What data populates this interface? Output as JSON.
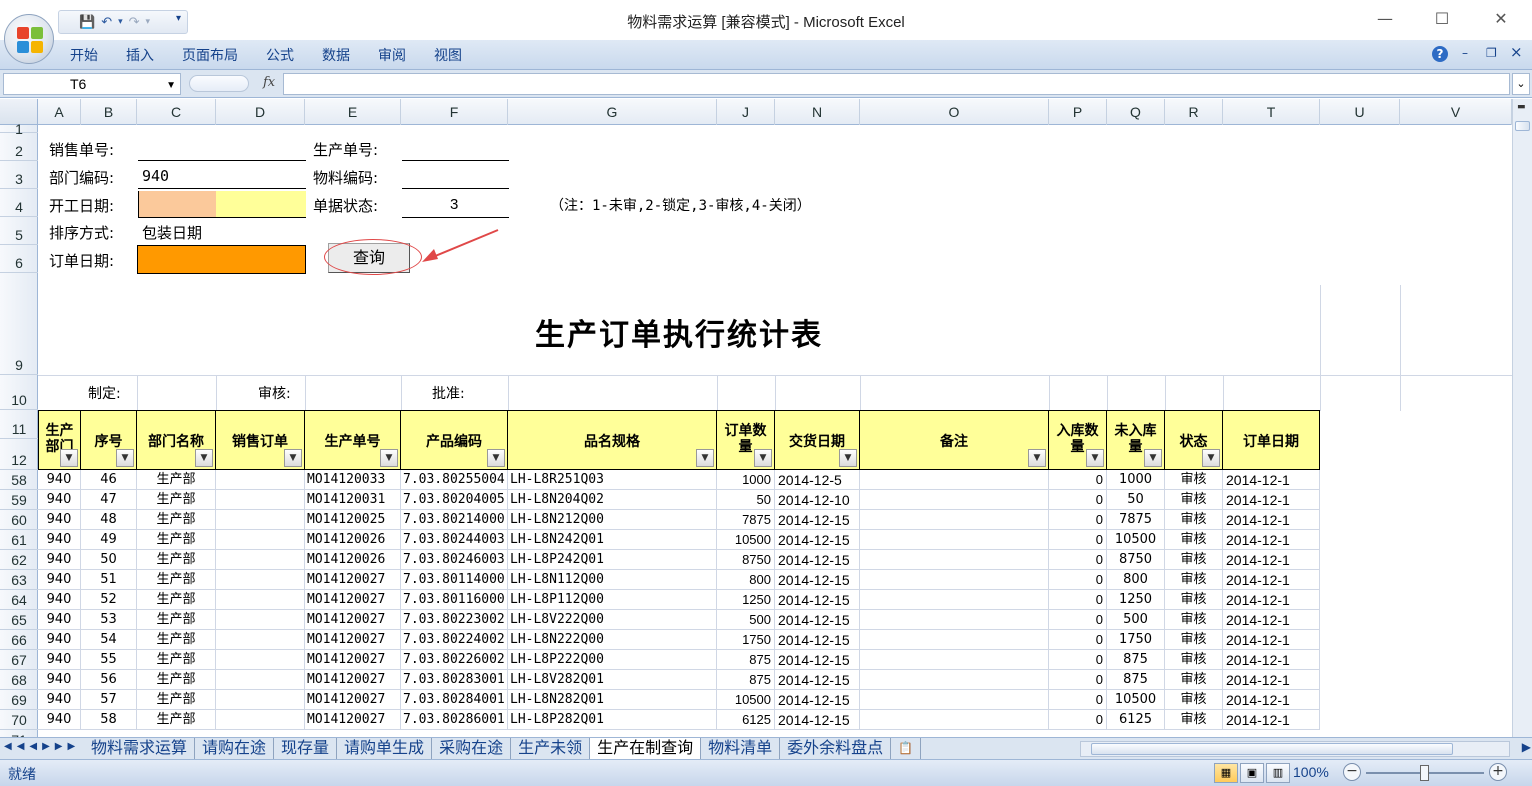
{
  "window": {
    "title": "物料需求运算  [兼容模式] - Microsoft Excel",
    "minimize": "—",
    "maximize": "☐",
    "close": "✕"
  },
  "qat": {
    "save": "💾",
    "undo": "↶",
    "redo": "↷",
    "more": "▾"
  },
  "ribbon": {
    "tabs": [
      "开始",
      "插入",
      "页面布局",
      "公式",
      "数据",
      "审阅",
      "视图"
    ],
    "help": "?",
    "min": "–",
    "restore": "❐",
    "close": "×"
  },
  "formula_bar": {
    "name_box": "T6",
    "fx": "fx",
    "value": ""
  },
  "columns": [
    "A",
    "B",
    "C",
    "D",
    "E",
    "F",
    "G",
    "J",
    "N",
    "O",
    "P",
    "Q",
    "R",
    "T",
    "U",
    "V"
  ],
  "row_numbers": [
    "1",
    "2",
    "3",
    "4",
    "5",
    "6",
    "9",
    "10",
    "11",
    "12",
    "58",
    "59",
    "60",
    "61",
    "62",
    "63",
    "64",
    "65",
    "66",
    "67",
    "68",
    "69",
    "70",
    "71"
  ],
  "form": {
    "sales_no_label": "销售单号:",
    "prod_no_label": "生产单号:",
    "dept_label": "部门编码:",
    "dept_value": "940",
    "material_label": "物料编码:",
    "start_date_label": "开工日期:",
    "status_label": "单据状态:",
    "status_value": "3",
    "status_note": "（注：1-未审,2-锁定,3-审核,4-关闭）",
    "sort_label": "排序方式:",
    "sort_value": "包装日期",
    "order_date_label": "订单日期:",
    "query_button": "查询"
  },
  "report": {
    "title": "生产订单执行统计表",
    "made_by": "制定:",
    "reviewed_by": "审核:",
    "approved_by": "批准:"
  },
  "table_headers": {
    "dept": "生产部门",
    "seq": "序号",
    "dept_name": "部门名称",
    "sales_order": "销售订单",
    "prod_no": "生产单号",
    "product_code": "产品编码",
    "spec": "品名规格",
    "order_qty": "订单数量",
    "delivery_date": "交货日期",
    "remark": "备注",
    "in_qty": "入库数量",
    "not_in_qty": "未入库量",
    "status": "状态",
    "order_date": "订单日期"
  },
  "rows": [
    {
      "dept": "940",
      "seq": "46",
      "dname": "生产部",
      "prod": "MO14120033",
      "code": "7.03.80255004",
      "spec": "LH-L8R251Q03",
      "qty": "1000",
      "date": "2014-12-5",
      "in": "0",
      "left": "1000",
      "st": "审核",
      "od": "2014-12-1"
    },
    {
      "dept": "940",
      "seq": "47",
      "dname": "生产部",
      "prod": "MO14120031",
      "code": "7.03.80204005",
      "spec": "LH-L8N204Q02",
      "qty": "50",
      "date": "2014-12-10",
      "in": "0",
      "left": "50",
      "st": "审核",
      "od": "2014-12-1"
    },
    {
      "dept": "940",
      "seq": "48",
      "dname": "生产部",
      "prod": "MO14120025",
      "code": "7.03.80214000",
      "spec": "LH-L8N212Q00",
      "qty": "7875",
      "date": "2014-12-15",
      "in": "0",
      "left": "7875",
      "st": "审核",
      "od": "2014-12-1"
    },
    {
      "dept": "940",
      "seq": "49",
      "dname": "生产部",
      "prod": "MO14120026",
      "code": "7.03.80244003",
      "spec": "LH-L8N242Q01",
      "qty": "10500",
      "date": "2014-12-15",
      "in": "0",
      "left": "10500",
      "st": "审核",
      "od": "2014-12-1"
    },
    {
      "dept": "940",
      "seq": "50",
      "dname": "生产部",
      "prod": "MO14120026",
      "code": "7.03.80246003",
      "spec": "LH-L8P242Q01",
      "qty": "8750",
      "date": "2014-12-15",
      "in": "0",
      "left": "8750",
      "st": "审核",
      "od": "2014-12-1"
    },
    {
      "dept": "940",
      "seq": "51",
      "dname": "生产部",
      "prod": "MO14120027",
      "code": "7.03.80114000",
      "spec": "LH-L8N112Q00",
      "qty": "800",
      "date": "2014-12-15",
      "in": "0",
      "left": "800",
      "st": "审核",
      "od": "2014-12-1"
    },
    {
      "dept": "940",
      "seq": "52",
      "dname": "生产部",
      "prod": "MO14120027",
      "code": "7.03.80116000",
      "spec": "LH-L8P112Q00",
      "qty": "1250",
      "date": "2014-12-15",
      "in": "0",
      "left": "1250",
      "st": "审核",
      "od": "2014-12-1"
    },
    {
      "dept": "940",
      "seq": "53",
      "dname": "生产部",
      "prod": "MO14120027",
      "code": "7.03.80223002",
      "spec": "LH-L8V222Q00",
      "qty": "500",
      "date": "2014-12-15",
      "in": "0",
      "left": "500",
      "st": "审核",
      "od": "2014-12-1"
    },
    {
      "dept": "940",
      "seq": "54",
      "dname": "生产部",
      "prod": "MO14120027",
      "code": "7.03.80224002",
      "spec": "LH-L8N222Q00",
      "qty": "1750",
      "date": "2014-12-15",
      "in": "0",
      "left": "1750",
      "st": "审核",
      "od": "2014-12-1"
    },
    {
      "dept": "940",
      "seq": "55",
      "dname": "生产部",
      "prod": "MO14120027",
      "code": "7.03.80226002",
      "spec": "LH-L8P222Q00",
      "qty": "875",
      "date": "2014-12-15",
      "in": "0",
      "left": "875",
      "st": "审核",
      "od": "2014-12-1"
    },
    {
      "dept": "940",
      "seq": "56",
      "dname": "生产部",
      "prod": "MO14120027",
      "code": "7.03.80283001",
      "spec": "LH-L8V282Q01",
      "qty": "875",
      "date": "2014-12-15",
      "in": "0",
      "left": "875",
      "st": "审核",
      "od": "2014-12-1"
    },
    {
      "dept": "940",
      "seq": "57",
      "dname": "生产部",
      "prod": "MO14120027",
      "code": "7.03.80284001",
      "spec": "LH-L8N282Q01",
      "qty": "10500",
      "date": "2014-12-15",
      "in": "0",
      "left": "10500",
      "st": "审核",
      "od": "2014-12-1"
    },
    {
      "dept": "940",
      "seq": "58",
      "dname": "生产部",
      "prod": "MO14120027",
      "code": "7.03.80286001",
      "spec": "LH-L8P282Q01",
      "qty": "6125",
      "date": "2014-12-15",
      "in": "0",
      "left": "6125",
      "st": "审核",
      "od": "2014-12-1"
    }
  ],
  "sheet_tabs": [
    "物料需求运算",
    "请购在途",
    "现存量",
    "请购单生成",
    "采购在途",
    "生产未领",
    "生产在制查询",
    "物料清单",
    "委外余料盘点"
  ],
  "active_sheet": "生产在制查询",
  "status": {
    "ready": "就绪",
    "zoom": "100%"
  },
  "colors": {
    "header_fill": "#ffff99",
    "start_date_fill_a": "#fbc99b",
    "start_date_fill_b": "#ffff99",
    "order_date_fill": "#ff9900",
    "annotation_red": "#e04848"
  }
}
